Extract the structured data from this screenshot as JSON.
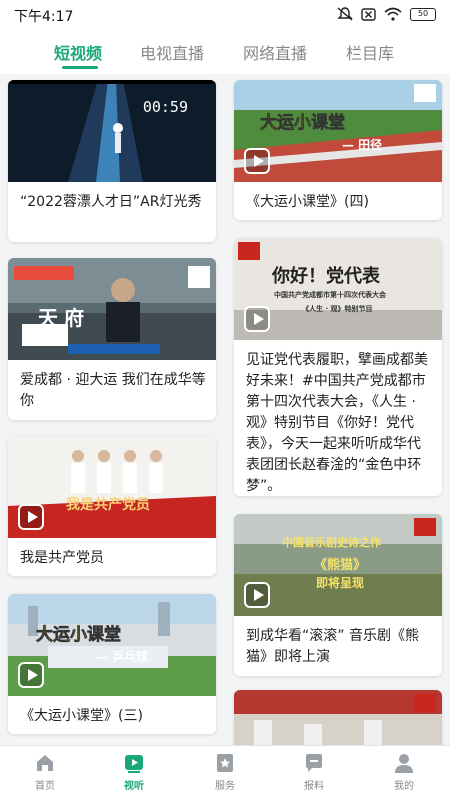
{
  "status": {
    "time": "下午4:17",
    "battery": "50"
  },
  "tabs": [
    {
      "label": "短视频"
    },
    {
      "label": "电视直播"
    },
    {
      "label": "网络直播"
    },
    {
      "label": "栏目库"
    }
  ],
  "feed": {
    "left": [
      {
        "title": "“2022蓉漂人才日”AR灯光秀",
        "duration": "00:59"
      },
      {
        "title": "爱成都 · 迎大运 我们在成华等你",
        "overlay": "天府"
      },
      {
        "title": "我是共产党员",
        "overlay": "我是共产党员"
      },
      {
        "title": "《大运小课堂》(三)",
        "overlay": "大运小课堂",
        "overlay_sub": "— 乒乓球"
      }
    ],
    "right": [
      {
        "title": "《大运小课堂》(四)",
        "overlay": "大运小课堂",
        "overlay_sub": "— 田径"
      },
      {
        "title": "见证党代表履职，擘画成都美好未来！#中国共产党成都市第十四次代表大会，《人生 · 观》特别节目《你好！党代表》，今天一起来听听成华代表团团长赵春淦的“金色中环梦”。",
        "overlay": "你好！党代表",
        "overlay_sub": "中国共产党成都市第十四次代表大会",
        "overlay_sub2": "《人生 · 观》特别节目"
      },
      {
        "title": "到成华看“滚滚” 音乐剧《熊猫》即将上演",
        "overlay": "中国音乐剧史诗之作",
        "overlay_sub": "《熊猫》",
        "overlay_sub2": "即将呈现"
      },
      {
        "title": ""
      }
    ]
  },
  "bottom_nav": [
    {
      "label": "首页"
    },
    {
      "label": "视听"
    },
    {
      "label": "服务"
    },
    {
      "label": "报料"
    },
    {
      "label": "我的"
    }
  ],
  "colors": {
    "accent": "#1aa87a"
  }
}
